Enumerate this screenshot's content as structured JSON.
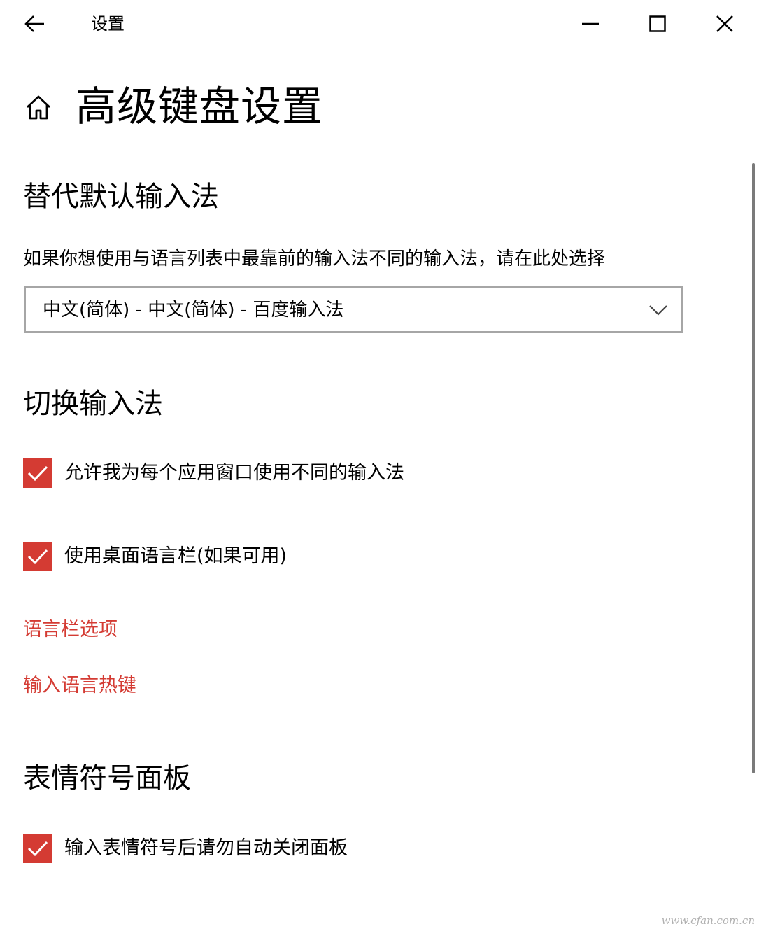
{
  "titlebar": {
    "app_title": "设置",
    "back_icon": "arrow-left-icon",
    "minimize_icon": "minimize-icon",
    "maximize_icon": "maximize-icon",
    "close_icon": "close-icon"
  },
  "header": {
    "home_icon": "home-icon",
    "page_title": "高级键盘设置"
  },
  "override_section": {
    "title": "替代默认输入法",
    "description": "如果你想使用与语言列表中最靠前的输入法不同的输入法，请在此处选择",
    "dropdown_value": "中文(简体) - 中文(简体) - 百度输入法",
    "dropdown_icon": "chevron-down-icon"
  },
  "switch_section": {
    "title": "切换输入法",
    "options": [
      {
        "label": "允许我为每个应用窗口使用不同的输入法",
        "checked": true
      },
      {
        "label": "使用桌面语言栏(如果可用)",
        "checked": true
      }
    ],
    "links": [
      "语言栏选项",
      "输入语言热键"
    ]
  },
  "emoji_section": {
    "title": "表情符号面板",
    "options": [
      {
        "label": "输入表情符号后请勿自动关闭面板",
        "checked": true
      }
    ]
  },
  "colors": {
    "accent": "#d43b33",
    "border": "#a6a6a6",
    "text": "#000000"
  },
  "watermark": "www.cfan.com.cn"
}
